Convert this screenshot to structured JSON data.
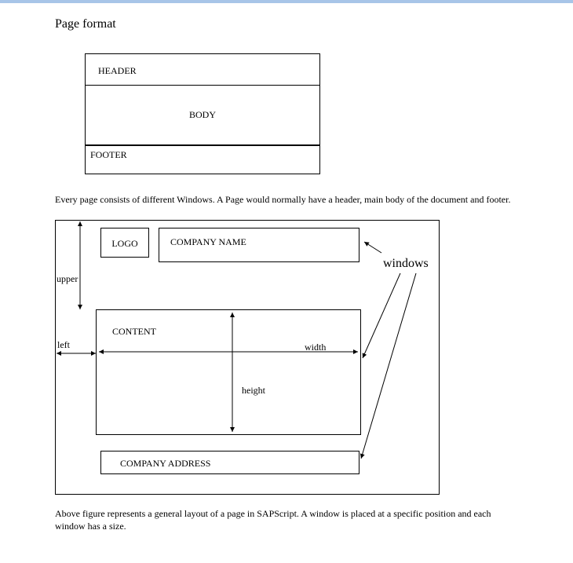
{
  "title": "Page format",
  "diagram1": {
    "header": "HEADER",
    "body": "BODY",
    "footer": "FOOTER"
  },
  "para1": "Every page consists of different Windows. A Page would normally have a header, main body of the document and footer.",
  "diagram2": {
    "logo": "LOGO",
    "company_name": "COMPANY NAME",
    "content": "CONTENT",
    "company_address": "COMPANY ADDRESS",
    "labels": {
      "upper": "upper",
      "left": "left",
      "width": "width",
      "height": "height",
      "windows": "windows"
    }
  },
  "para2": "Above figure represents a general layout of a page in SAPScript. A window is placed at a specific position and each window has a size."
}
